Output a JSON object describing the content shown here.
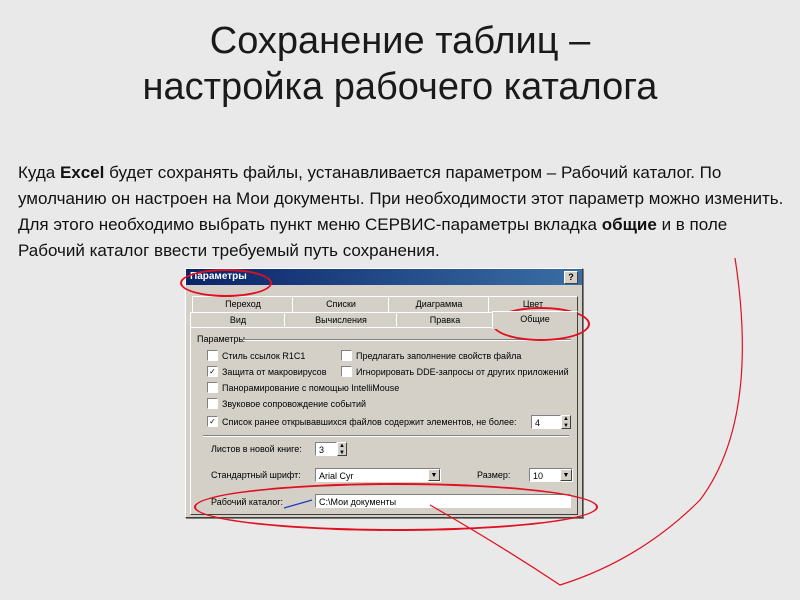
{
  "slide": {
    "title_line1": "Сохранение таблиц –",
    "title_line2": "настройка рабочего каталога",
    "body": {
      "p1": "Куда ",
      "p2": "Excel",
      "p3": " будет сохранять файлы, устанавливается параметром – Рабочий каталог. По умолчанию он настроен на Мои документы. При необходимости этот параметр можно изменить. Для этого необходимо выбрать пункт меню СЕРВИС-параметры  вкладка ",
      "p4": "общие",
      "p5": " и в поле Рабочий каталог ввести требуемый путь сохранения."
    }
  },
  "dialog": {
    "title": "Параметры",
    "help": "?",
    "tabs_top": [
      "Переход",
      "Списки",
      "Диаграмма",
      "Цвет"
    ],
    "tabs_bottom": [
      "Вид",
      "Вычисления",
      "Правка",
      "Общие"
    ],
    "group_label": "Параметры",
    "checkboxes": [
      {
        "label": "Стиль ссылок R1C1",
        "checked": false
      },
      {
        "label": "Предлагать заполнение свойств файла",
        "checked": false
      },
      {
        "label": "Защита от макровирусов",
        "checked": true
      },
      {
        "label": "Игнорировать DDE-запросы от других приложений",
        "checked": false
      },
      {
        "label": "Панорамирование с помощью IntelliMouse",
        "checked": false
      },
      {
        "label": "Звуковое сопровождение событий",
        "checked": false
      },
      {
        "label": "Список ранее открывавшихся файлов содержит элементов, не более:",
        "checked": true
      }
    ],
    "recent_count": "4",
    "sheets_label": "Листов в новой книге:",
    "sheets_value": "3",
    "font_label": "Стандартный шрифт:",
    "font_value": "Arial Cyr",
    "size_label": "Размер:",
    "size_value": "10",
    "workdir_label": "Рабочий каталог:",
    "workdir_value": "C:\\Мои документы",
    "check_mark": "✓",
    "spin_up": "▲",
    "spin_down": "▼",
    "dropdown_arrow": "▼"
  },
  "colors": {
    "highlight": "#e01020",
    "titlebar": "#0a246a",
    "dialog_bg": "#d4d0c8"
  }
}
